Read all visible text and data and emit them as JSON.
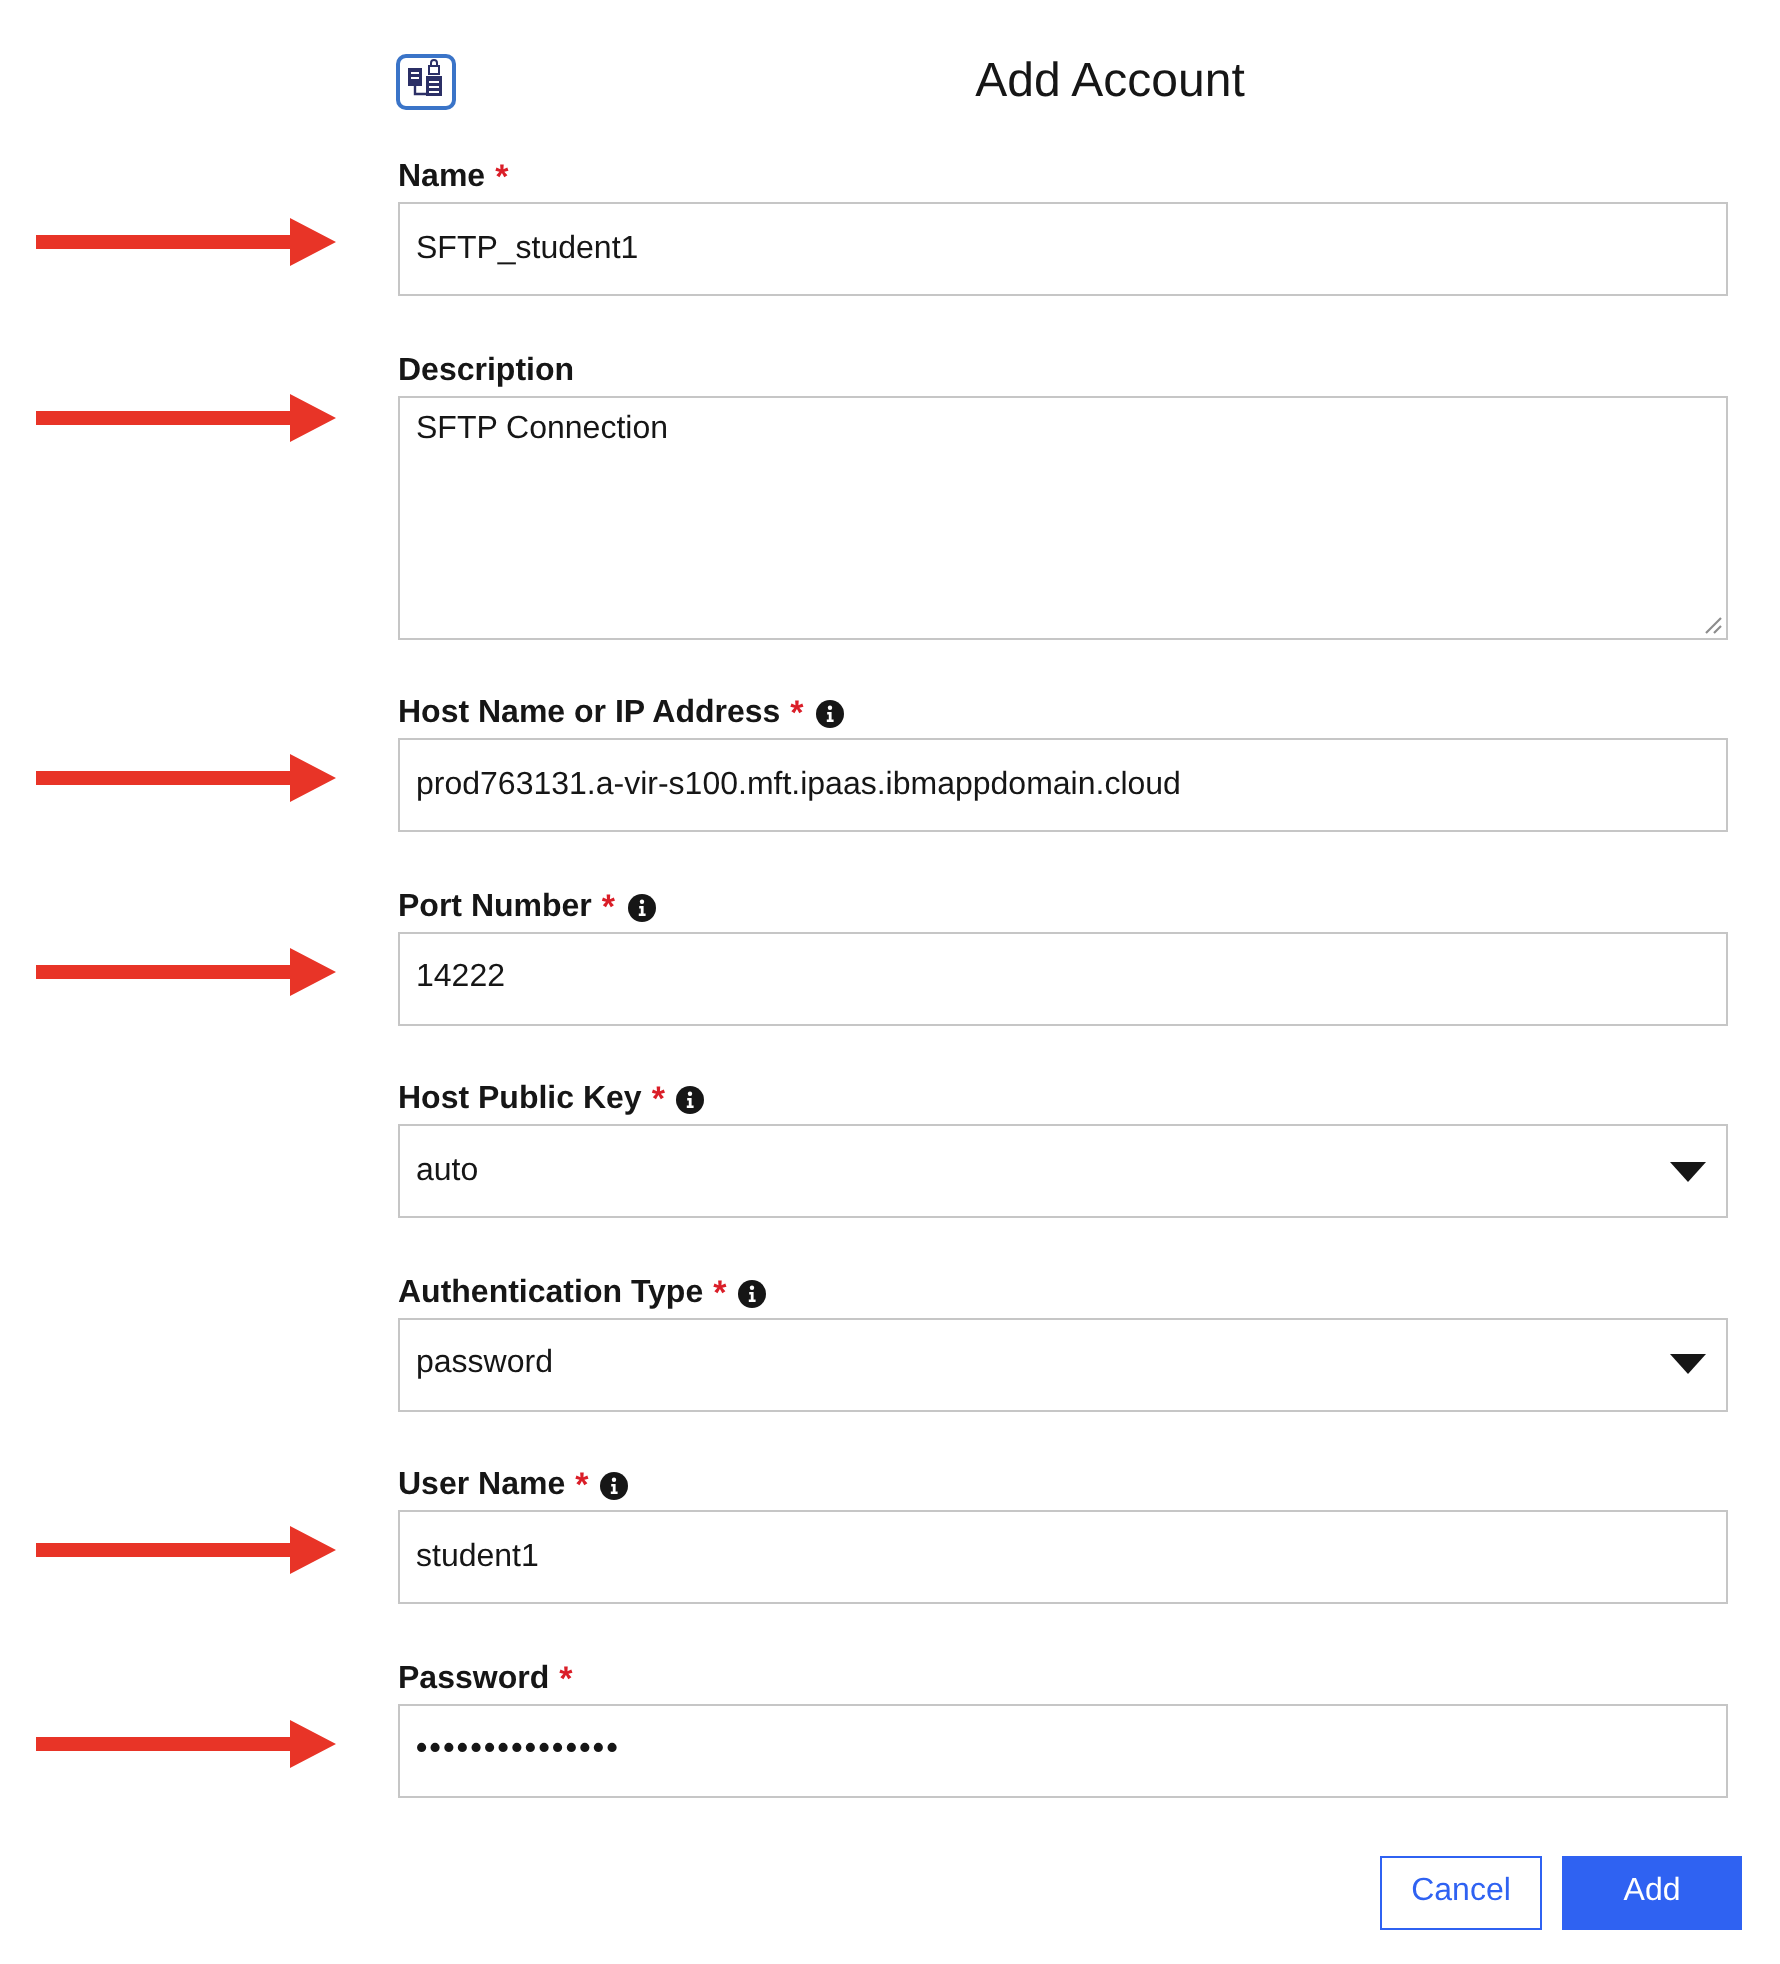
{
  "header": {
    "title": "Add Account"
  },
  "fields": [
    {
      "kind": "text",
      "label": "Name",
      "required_mark": "*",
      "info": false,
      "value": "SFTP_student1",
      "arrow": true
    },
    {
      "kind": "textarea",
      "label": "Description",
      "info": false,
      "value": "SFTP Connection",
      "arrow": true
    },
    {
      "kind": "text",
      "label": "Host Name or IP Address",
      "required_mark": "*",
      "info": true,
      "value": "prod763131.a-vir-s100.mft.ipaas.ibmappdomain.cloud",
      "arrow": true
    },
    {
      "kind": "text",
      "label": "Port Number",
      "required_mark": "*",
      "info": true,
      "value": "14222",
      "arrow": true
    },
    {
      "kind": "select",
      "label": "Host Public Key",
      "required_mark": "*",
      "info": true,
      "value": "auto",
      "arrow": false
    },
    {
      "kind": "select",
      "label": "Authentication Type",
      "required_mark": "*",
      "info": true,
      "value": "password",
      "arrow": false
    },
    {
      "kind": "text",
      "label": "User Name",
      "required_mark": "*",
      "info": true,
      "value": "student1",
      "arrow": true
    },
    {
      "kind": "password",
      "label": "Password",
      "required_mark": "*",
      "info": false,
      "value": "•••••••••••••••",
      "arrow": true
    }
  ],
  "buttons": [
    {
      "label": "Cancel",
      "kind": "secondary"
    },
    {
      "label": "Add",
      "kind": "primary"
    }
  ]
}
